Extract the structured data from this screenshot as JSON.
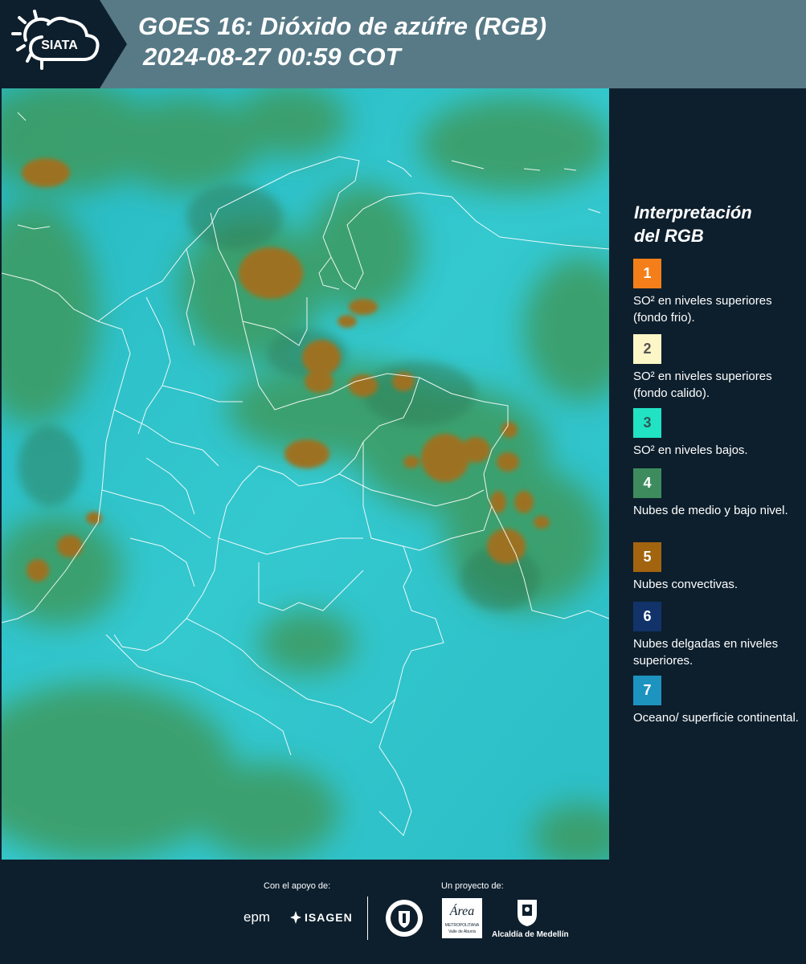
{
  "header": {
    "logo_text": "SIATA",
    "title_line1": "GOES 16: Dióxido de azúfre (RGB)",
    "title_line2": "2024-08-27 00:59 COT"
  },
  "legend": {
    "title_line1": "Interpretación",
    "title_line2": "del RGB",
    "items": [
      {
        "number": "1",
        "color": "#f47f1a",
        "text": "SO² en niveles superiores (fondo frio)."
      },
      {
        "number": "2",
        "color": "#fdf6c6",
        "text": "SO² en niveles superiores (fondo calido)."
      },
      {
        "number": "3",
        "color": "#21e3c4",
        "text": "SO² en niveles bajos."
      },
      {
        "number": "4",
        "color": "#3e8c5e",
        "text": "Nubes de medio y bajo nivel."
      },
      {
        "number": "5",
        "color": "#a3640f",
        "text": "Nubes convectivas."
      },
      {
        "number": "6",
        "color": "#11336a",
        "text": "Nubes delgadas en niveles superiores."
      },
      {
        "number": "7",
        "color": "#1d93c0",
        "text": "Oceano/ superficie continental."
      }
    ]
  },
  "footer": {
    "support_label": "Con el apoyo de:",
    "project_label": "Un proyecto de:",
    "epm": "epm",
    "isagen": "ISAGEN",
    "area_name": "Área",
    "area_sub1": "METROPOLITANA",
    "area_sub2": "Valle de Aburrá",
    "alcaldia": "Alcaldía de Medellín"
  },
  "colors": {
    "header_bg": "#577a86",
    "panel_bg": "#0d1f2d",
    "map_base": "#2bc0c8",
    "cloud_green": "#3f9a60",
    "convective": "#9a6f1f"
  }
}
